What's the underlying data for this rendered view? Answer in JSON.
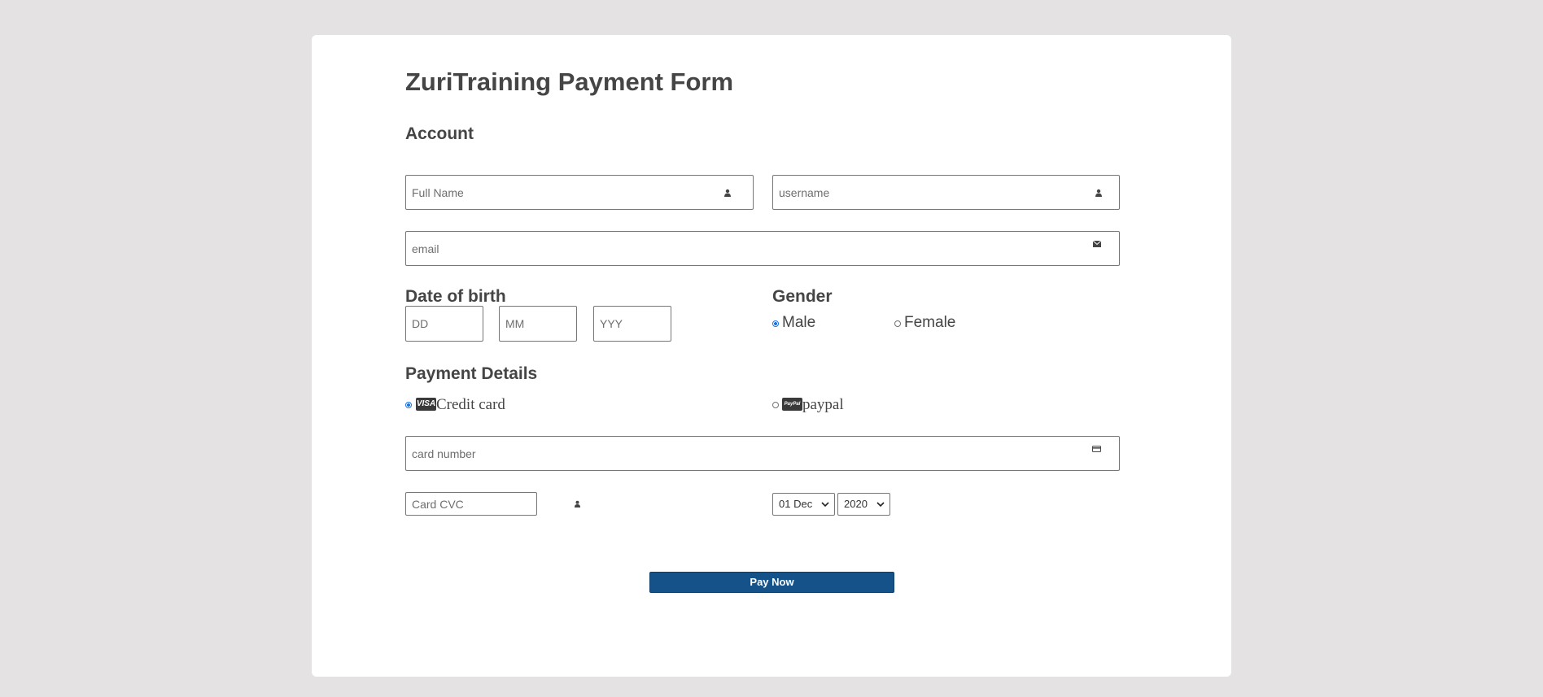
{
  "form": {
    "title": "ZuriTraining Payment Form",
    "account_heading": "Account",
    "full_name": {
      "placeholder": "Full Name",
      "icon": "user-icon"
    },
    "username": {
      "placeholder": "username",
      "icon": "user-icon"
    },
    "email": {
      "placeholder": "email",
      "icon": "envelope-icon"
    },
    "dob": {
      "heading": "Date of birth",
      "day_placeholder": "DD",
      "month_placeholder": "MM",
      "year_placeholder": "YYY"
    },
    "gender": {
      "heading": "Gender",
      "options": [
        {
          "label": "Male",
          "checked": true
        },
        {
          "label": "Female",
          "checked": false
        }
      ]
    },
    "payment": {
      "heading": "Payment Details",
      "methods": [
        {
          "label": "Credit card",
          "badge": "VISA",
          "checked": true,
          "icon": "visa-icon"
        },
        {
          "label": "paypal",
          "badge": "PayPal",
          "checked": false,
          "icon": "paypal-icon"
        }
      ],
      "card_number_placeholder": "card number",
      "card_icon": "credit-card-icon",
      "cvc_placeholder": "Card CVC",
      "cvc_icon": "user-icon",
      "expiry_date": "01 Dec",
      "expiry_year": "2020"
    },
    "submit_label": "Pay Now"
  },
  "colors": {
    "page_bg": "#e4e2e3",
    "card_bg": "#ffffff",
    "text": "#454545",
    "button_bg": "#155289",
    "radio_accent": "#1a73e8"
  }
}
